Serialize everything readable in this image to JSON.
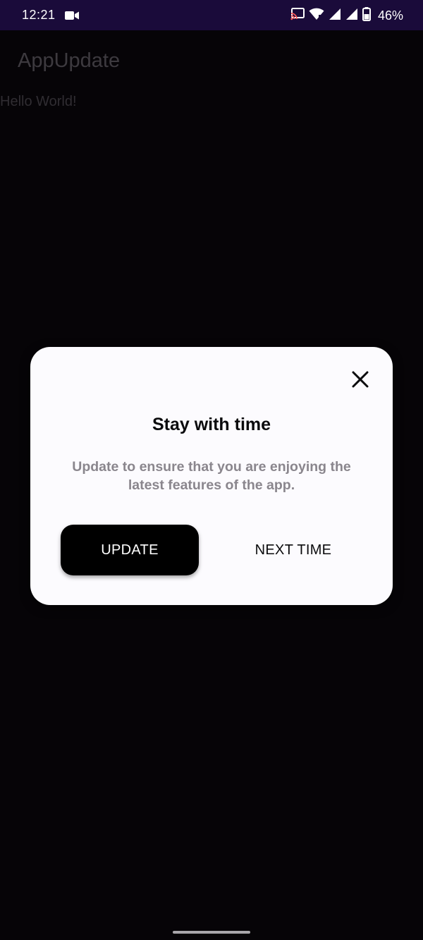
{
  "status_bar": {
    "time": "12:21",
    "battery_percent": "46%",
    "background_color": "#1a0b3a",
    "icons": [
      "video-camera-icon",
      "cast-icon",
      "wifi-icon",
      "signal-icon",
      "signal-icon",
      "battery-icon"
    ]
  },
  "app": {
    "title": "AppUpdate",
    "body_text": "Hello World!"
  },
  "dialog": {
    "close_icon": "close-icon",
    "title": "Stay with time",
    "message": "Update to ensure that you are enjoying the latest features of the app.",
    "primary_button_label": "UPDATE",
    "secondary_button_label": "NEXT TIME",
    "primary_button_color": "#000000",
    "background_color": "#fcfbfe"
  }
}
